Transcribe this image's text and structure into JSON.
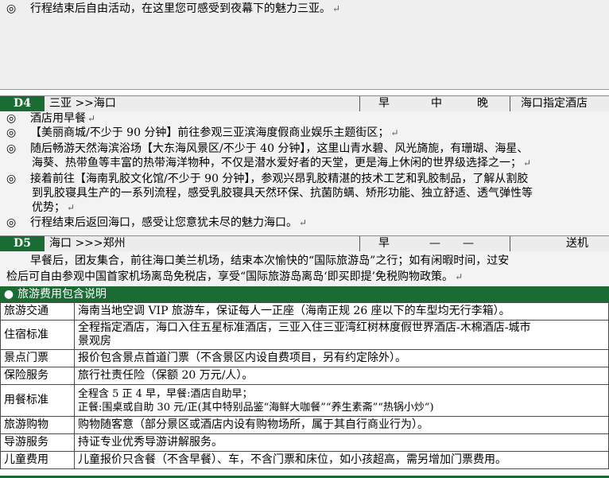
{
  "prev_day": {
    "line": "行程结束后自由活动，在这里您可感受到夜幕下的魅力三亚。"
  },
  "bullet_symbol": "◎",
  "para_mark": "↵",
  "d4": {
    "day": "D4",
    "route": "三亚 >>海口",
    "meals": [
      "早",
      "中",
      "晚"
    ],
    "hotel": "海口指定酒店",
    "items": [
      [
        "酒店用早餐"
      ],
      [
        "【美丽商城/不少于 90 分钟】前往参观三亚滨海度假商业娱乐主题街区；"
      ],
      [
        "随后畅游天然海滨浴场【大东海风景区/不少于 40 分钟】，这里山青水碧、风光旖旎，有珊瑚、海星、",
        "海葵、热带鱼等丰富的热带海洋物种，不仅是潜水爱好者的天堂，更是海上休闲的世界级选择之一；"
      ],
      [
        "接着前往【海南乳胶文化馆/不少于 90 分钟】，参观兴昂乳胶精湛的技术工艺和乳胶制品，了解从割胶",
        "到乳胶寝具生产的一系列流程，感受乳胶寝具天然环保、抗菌防螨、矫形功能、独立舒适、透气弹性等",
        "优势；"
      ],
      [
        "行程结束后返回海口，感受让您意犹未尽的魅力海口。"
      ]
    ]
  },
  "d5": {
    "day": "D5",
    "route": "海口 >>>郑州",
    "meals": [
      "早",
      "—",
      "—"
    ],
    "hotel": "送机",
    "desc": [
      "早餐后，团友集合，前往海口美兰机场，结束本次愉快的“国际旅游岛”之行；如有闲暇时间，过安",
      "检后可自由参观中国首家机场离岛免税店，享受“国际旅游岛离岛‘即买即提’免税购物政策。"
    ]
  },
  "cost": {
    "header": "旅游费用包含说明",
    "header_icon": "●",
    "rows": [
      {
        "label": "旅游交通",
        "value": [
          "海南当地空调 VIP 旅游车，保证每人一正座（海南正规 26 座以下的车型均无行李箱）。"
        ]
      },
      {
        "label": "住宿标准",
        "value": [
          "全程指定酒店，海口入住五星标准酒店，三亚入住三亚湾红树林度假世界酒店-木棉酒店-城市",
          "景观房"
        ]
      },
      {
        "label": "景点门票",
        "value": [
          "报价包含景点首道门票（不含景区内设自费项目，另有约定除外）。"
        ]
      },
      {
        "label": "保险服务",
        "value": [
          "旅行社责任险（保额 20 万元/人）。"
        ]
      },
      {
        "label": "用餐标准",
        "value": [
          "全程含 5 正 4 早，早餐:酒店自助早；",
          "正餐:围桌或自助  30 元/正(其中特别品鉴“海鲜大咖餐”“养生素斋”“热锅小炒”)"
        ]
      },
      {
        "label": "旅游购物",
        "value": [
          "购物随客意（部分景区或酒店内设有购物场所，属于其自行商业行为）。"
        ]
      },
      {
        "label": "导游服务",
        "value": [
          "持证专业优秀导游讲解服务。"
        ]
      },
      {
        "label": "儿童费用",
        "value": [
          "儿童报价只含餐（不含早餐）、车，不含门票和床位，如小孩超高，需另增加门票费用。"
        ]
      }
    ]
  }
}
